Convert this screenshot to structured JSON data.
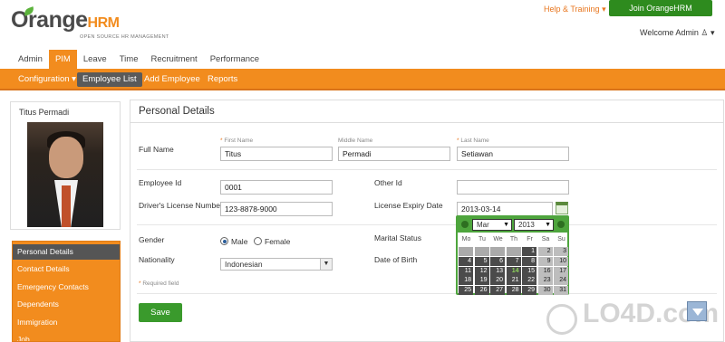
{
  "header": {
    "logo_text_main": "Orange",
    "logo_text_accent": "HRM",
    "logo_sub": "OPEN SOURCE HR MANAGEMENT",
    "help_link": "Help & Training",
    "join_button": "Join OrangeHRM Community",
    "welcome": "Welcome Admin"
  },
  "nav": {
    "tabs": [
      "Admin",
      "PIM",
      "Leave",
      "Time",
      "Recruitment",
      "Performance"
    ],
    "active": "PIM"
  },
  "subnav": {
    "items": [
      "Configuration",
      "Employee List",
      "Add Employee",
      "Reports"
    ],
    "active": "Employee List"
  },
  "profile": {
    "name": "Titus Permadi"
  },
  "sidemenu": {
    "items": [
      "Personal Details",
      "Contact Details",
      "Emergency Contacts",
      "Dependents",
      "Immigration",
      "Job"
    ],
    "active": "Personal Details"
  },
  "form": {
    "title": "Personal Details",
    "full_name_label": "Full Name",
    "first_name_label": "First Name",
    "middle_name_label": "Middle Name",
    "last_name_label": "Last Name",
    "first_name": "Titus",
    "middle_name": "Permadi",
    "last_name": "Setiawan",
    "employee_id_label": "Employee Id",
    "employee_id": "0001",
    "other_id_label": "Other Id",
    "other_id": "",
    "license_label": "Driver's License Number",
    "license": "123-8878-9000",
    "license_expiry_label": "License Expiry Date",
    "license_expiry": "2013-03-14",
    "gender_label": "Gender",
    "gender_male": "Male",
    "gender_female": "Female",
    "gender_selected": "Male",
    "marital_label": "Marital Status",
    "nationality_label": "Nationality",
    "nationality": "Indonesian",
    "dob_label": "Date of Birth",
    "required_note": "Required field",
    "required_mark": "*",
    "save_button": "Save"
  },
  "calendar": {
    "month": "Mar",
    "year": "2013",
    "weekdays": [
      "Mo",
      "Tu",
      "We",
      "Th",
      "Fr",
      "Sa",
      "Su"
    ],
    "weeks": [
      [
        "",
        "",
        "",
        "",
        "1",
        "2",
        "3"
      ],
      [
        "4",
        "5",
        "6",
        "7",
        "8",
        "9",
        "10"
      ],
      [
        "11",
        "12",
        "13",
        "14",
        "15",
        "16",
        "17"
      ],
      [
        "18",
        "19",
        "20",
        "21",
        "22",
        "23",
        "24"
      ],
      [
        "25",
        "26",
        "27",
        "28",
        "29",
        "30",
        "31"
      ]
    ],
    "selected_day": "14"
  },
  "watermark": "LO4D.com",
  "colors": {
    "brand_orange": "#f28c1e",
    "brand_green": "#2e8b1e",
    "calendar_green": "#4ea53d"
  }
}
